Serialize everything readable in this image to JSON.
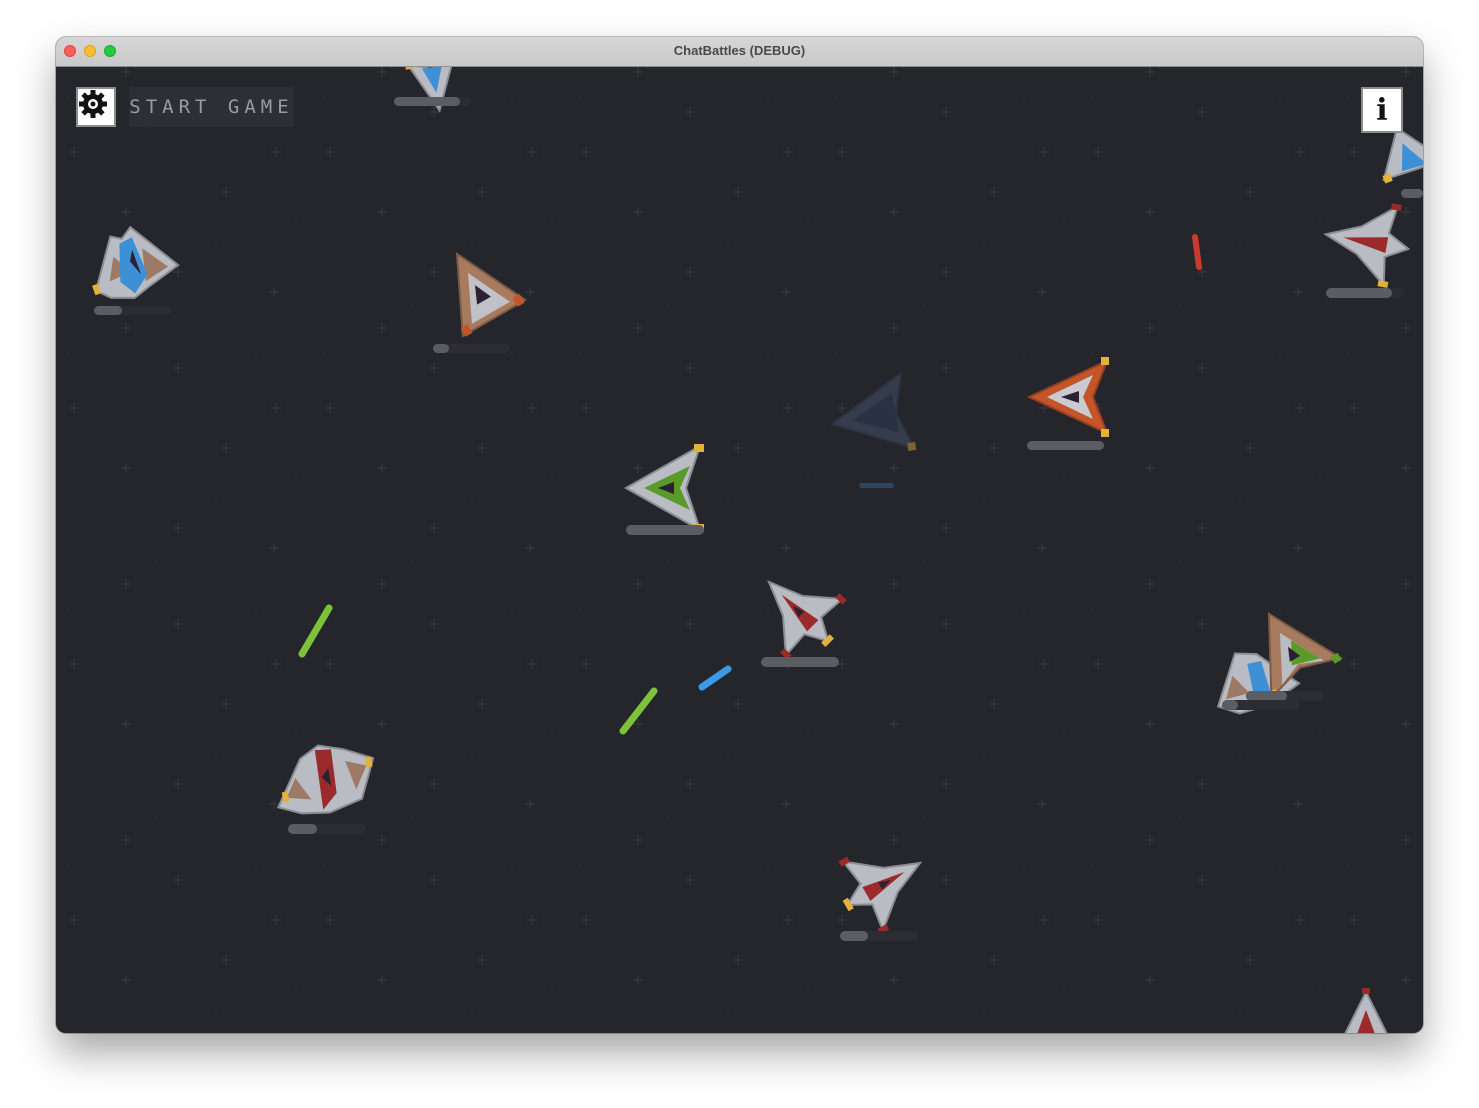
{
  "window": {
    "title": "ChatBattles (DEBUG)"
  },
  "toolbar": {
    "settings_icon": "gear-icon",
    "start_label": "START GAME",
    "info_icon": "info-icon",
    "info_glyph": "i"
  },
  "colors": {
    "background": "#25262b",
    "blue_team": "#3d8fd6",
    "red_team": "#9b2a2a",
    "green_team": "#5a9a2a",
    "orange_team": "#c4552a",
    "laser_green": "#7cc23a",
    "laser_blue": "#3a9ae8",
    "laser_red": "#c8392e"
  },
  "ships": [
    {
      "id": "ship-1",
      "team": "blue",
      "health": 0.0
    },
    {
      "id": "ship-2",
      "team": "blue",
      "health": 0.35
    },
    {
      "id": "ship-3",
      "team": "brown",
      "health": 0.2
    },
    {
      "id": "ship-4",
      "team": "green",
      "health": 1.0
    },
    {
      "id": "ship-5",
      "team": "orange",
      "health": 1.0
    },
    {
      "id": "ship-6",
      "team": "navy",
      "health": 1.0
    },
    {
      "id": "ship-7",
      "team": "red",
      "health": 1.0
    },
    {
      "id": "ship-8",
      "team": "red",
      "health": 0.85
    },
    {
      "id": "ship-9",
      "team": "blue",
      "health": 1.0
    },
    {
      "id": "ship-10",
      "team": "green",
      "health": 0.2
    },
    {
      "id": "ship-11",
      "team": "red",
      "health": 0.35
    },
    {
      "id": "ship-12",
      "team": "red",
      "health": 0.35
    }
  ]
}
